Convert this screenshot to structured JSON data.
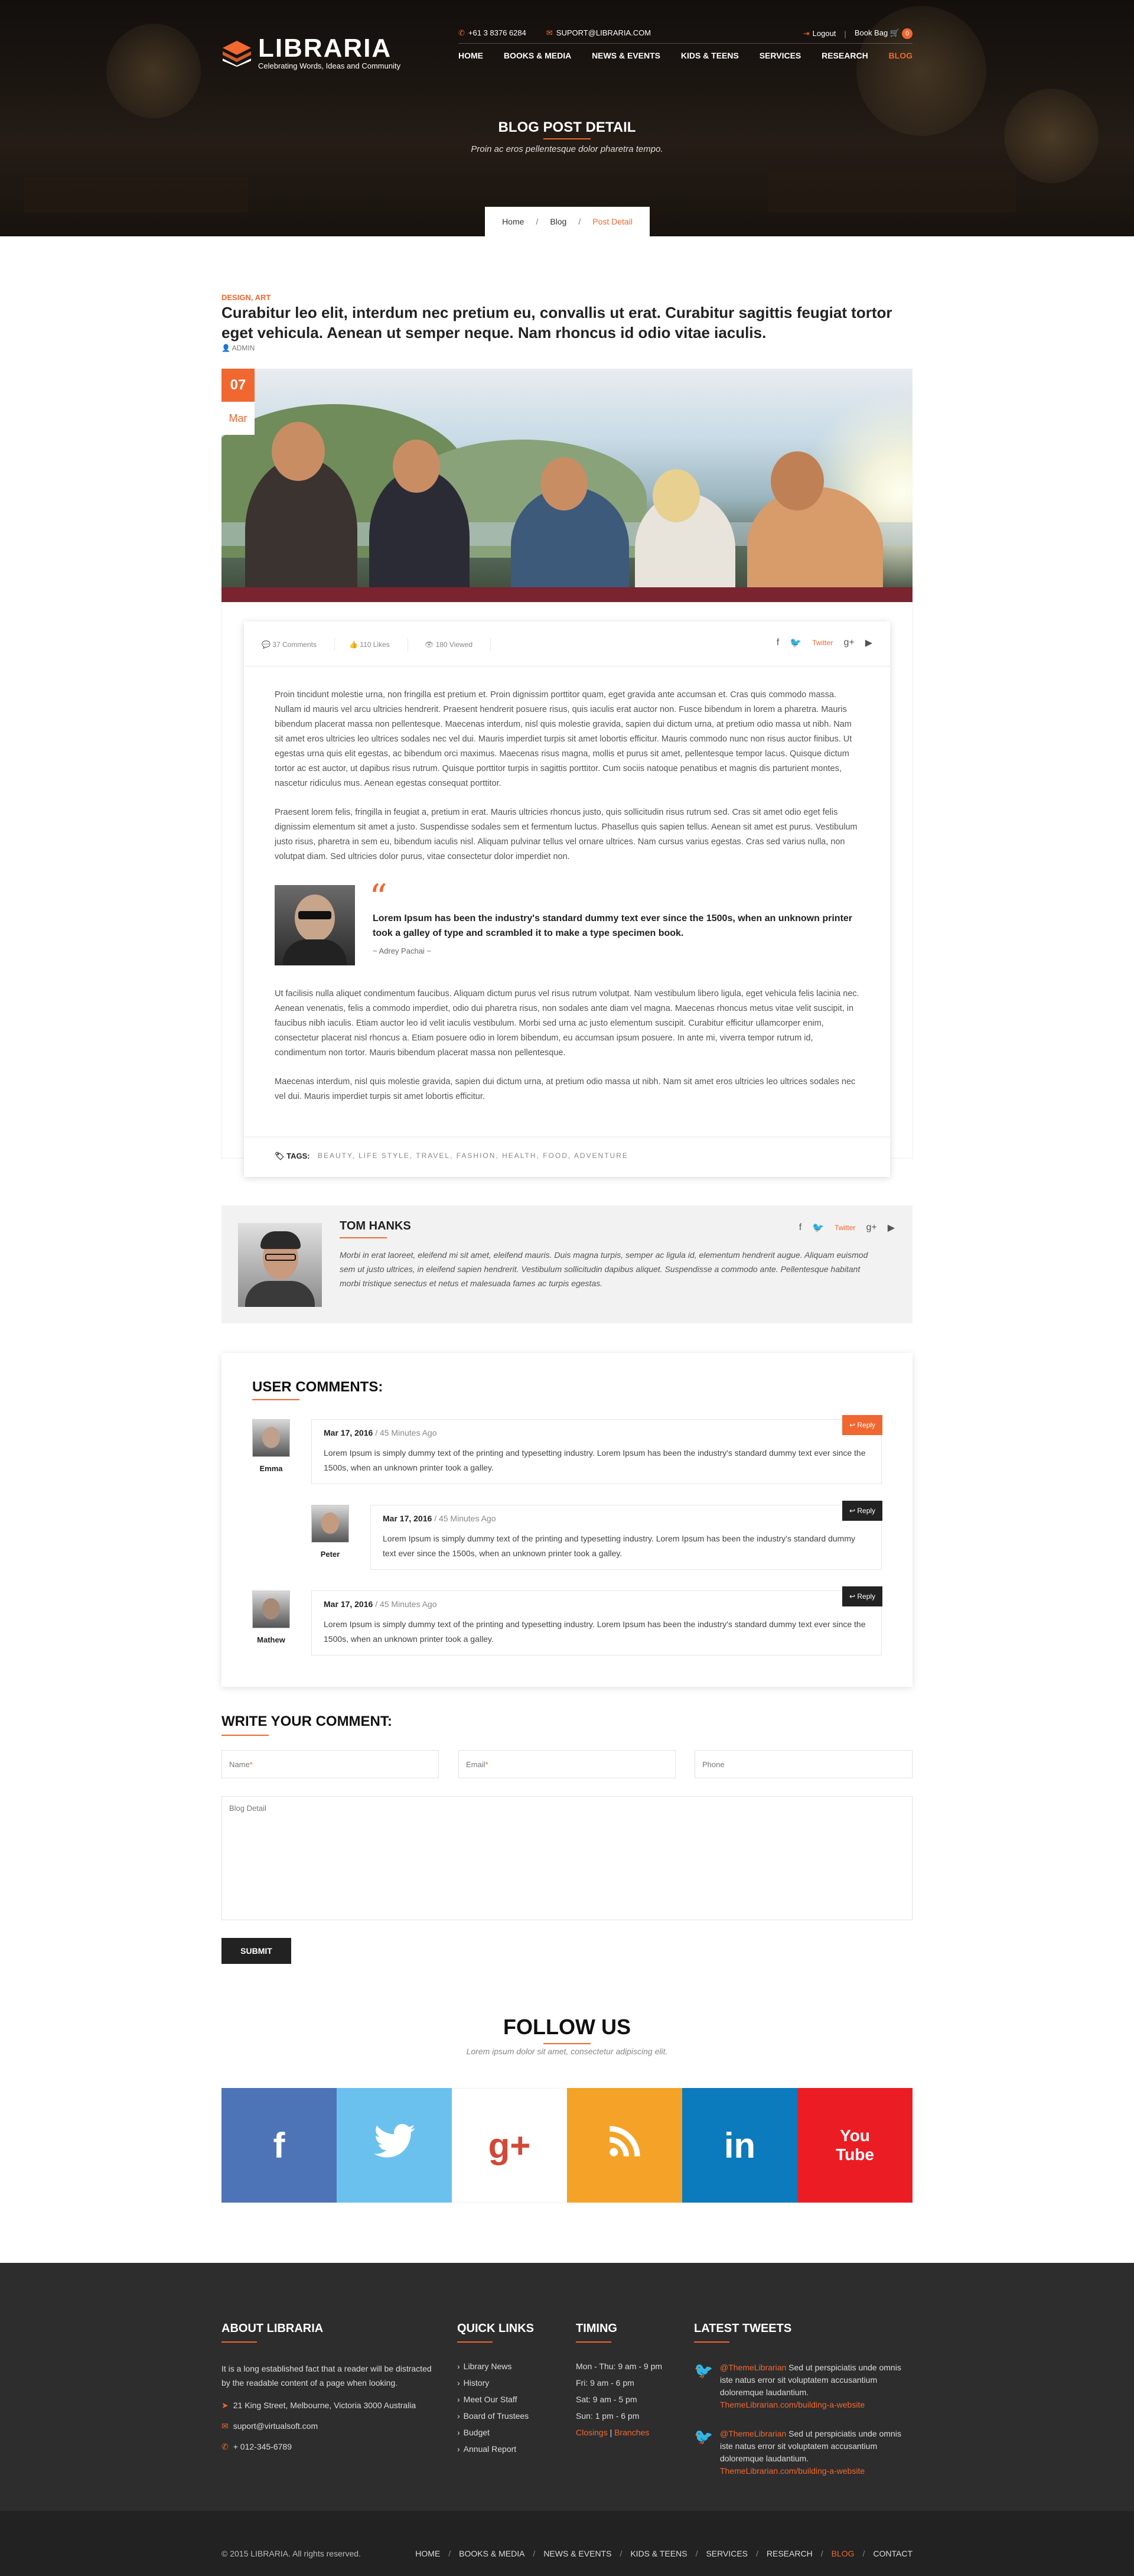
{
  "brand": {
    "name": "LIBRARIA",
    "tagline": "Celebrating Words, Ideas and Community"
  },
  "topbar": {
    "phone": "+61 3 8376 6284",
    "email": "SUPORT@LIBRARIA.COM",
    "logout": "Logout",
    "bookbag": "Book Bag",
    "bag_count": "0"
  },
  "nav": {
    "items": [
      "HOME",
      "BOOKS & MEDIA",
      "NEWS & EVENTS",
      "KIDS & TEENS",
      "SERVICES",
      "RESEARCH",
      "BLOG"
    ]
  },
  "hero": {
    "title": "BLOG POST DETAIL",
    "subtitle": "Proin ac eros pellentesque dolor pharetra tempo."
  },
  "breadcrumb": {
    "home": "Home",
    "blog": "Blog",
    "current": "Post Detail",
    "separator": "/"
  },
  "post": {
    "category": "DESIGN, ART",
    "title": "Curabitur leo elit, interdum nec pretium eu, convallis ut erat. Curabitur sagittis feugiat tortor eget vehicula. Aenean ut semper neque. Nam rhoncus id odio vitae iaculis.",
    "author": "ADMIN",
    "date_day": "07",
    "date_month": "Mar",
    "comments": "37 Comments",
    "likes": "110 Likes",
    "views": "180 Viewed",
    "twitter_label": "Twitter",
    "para1": "Proin tincidunt molestie urna, non fringilla est pretium et. Proin dignissim porttitor quam, eget gravida ante accumsan et. Cras quis commodo massa. Nullam id mauris vel arcu ultricies hendrerit. Praesent hendrerit posuere risus, quis iaculis erat auctor non. Fusce bibendum in lorem a pharetra. Mauris bibendum placerat massa non pellentesque. Maecenas interdum, nisl quis molestie gravida, sapien dui dictum urna, at pretium odio massa ut nibh. Nam sit amet eros ultricies leo ultrices sodales nec vel dui. Mauris imperdiet turpis sit amet lobortis efficitur. Mauris commodo nunc non risus auctor finibus. Ut egestas urna quis elit egestas, ac bibendum orci maximus. Maecenas risus magna, mollis et purus sit amet, pellentesque tempor lacus. Quisque dictum tortor ac est auctor, ut dapibus risus rutrum. Quisque porttitor turpis in sagittis porttitor. Cum sociis natoque penatibus et magnis dis parturient montes, nascetur ridiculus mus. Aenean egestas consequat porttitor.",
    "para2": "Praesent lorem felis, fringilla in feugiat a, pretium in erat. Mauris ultricies rhoncus justo, quis sollicitudin risus rutrum sed. Cras sit amet odio eget felis dignissim elementum sit amet a justo. Suspendisse sodales sem et fermentum luctus. Phasellus quis sapien tellus. Aenean sit amet est purus. Vestibulum justo risus, pharetra in sem eu, bibendum iaculis nisl. Aliquam pulvinar tellus vel ornare ultrices. Nam cursus varius egestas. Cras sed varius nulla, non volutpat diam. Sed ultricies dolor purus, vitae consectetur dolor imperdiet non.",
    "quote": "Lorem Ipsum has been the industry's standard dummy text ever since the 1500s, when an unknown printer took a galley of type and scrambled it to make a type specimen book.",
    "quote_author": "~ Adrey Pachai ~",
    "para3": "Ut facilisis nulla aliquet condimentum faucibus. Aliquam dictum purus vel risus rutrum volutpat. Nam vestibulum libero ligula, eget vehicula felis lacinia nec. Aenean venenatis, felis a commodo imperdiet, odio dui pharetra risus, non sodales ante diam vel magna. Maecenas rhoncus metus vitae velit suscipit, in faucibus nibh iaculis. Etiam auctor leo id velit iaculis vestibulum. Morbi sed urna ac justo elementum suscipit. Curabitur efficitur ullamcorper enim, consectetur placerat nisl rhoncus a. Etiam posuere odio in lorem bibendum, eu accumsan ipsum posuere. In ante mi, viverra tempor rutrum id, condimentum non tortor. Mauris bibendum placerat massa non pellentesque.",
    "para4": "Maecenas interdum, nisl quis molestie gravida, sapien dui dictum urna, at pretium odio massa ut nibh. Nam sit amet eros ultricies leo ultrices sodales nec vel dui. Mauris imperdiet turpis sit amet lobortis efficitur.",
    "tags_label": "TAGS:",
    "tags": "BEAUTY, LIFE STYLE, TRAVEL, FASHION, HEALTH, FOOD, ADVENTURE"
  },
  "author_box": {
    "name": "TOM HANKS",
    "twitter_label": "Twitter",
    "bio": "Morbi in erat laoreet, eleifend mi sit amet, eleifend mauris. Duis magna turpis, semper ac ligula id, elementum hendrerit augue. Aliquam euismod sem ut justo ultrices, in eleifend sapien hendrerit. Vestibulum sollicitudin dapibus aliquet. Suspendisse a commodo ante. Pellentesque habitant morbi tristique senectus et netus et malesuada fames ac turpis egestas."
  },
  "comments": {
    "title": "USER COMMENTS:",
    "reply_label": "Reply",
    "items": [
      {
        "name": "Emma",
        "date": "Mar 17, 2016",
        "ago": "45 Minutes Ago",
        "text": "Lorem Ipsum is simply dummy text of the printing and typesetting industry. Lorem Ipsum has been the industry's standard dummy text ever since the 1500s, when an unknown printer took a galley."
      },
      {
        "name": "Peter",
        "date": "Mar 17, 2016",
        "ago": "45 Minutes Ago",
        "text": "Lorem Ipsum is simply dummy text of the printing and typesetting industry. Lorem Ipsum has been the industry's standard dummy text ever since the 1500s, when an unknown printer took a galley."
      },
      {
        "name": "Mathew",
        "date": "Mar 17, 2016",
        "ago": "45 Minutes Ago",
        "text": "Lorem Ipsum is simply dummy text of the printing and typesetting industry. Lorem Ipsum has been the industry's standard dummy text ever since the 1500s, when an unknown printer took a galley."
      }
    ]
  },
  "write_comment": {
    "title": "WRITE YOUR COMMENT:",
    "name_placeholder": "Name",
    "email_placeholder": "Email",
    "phone_placeholder": "Phone",
    "detail_placeholder": "Blog Detail",
    "required_mark": "*",
    "submit": "SUBMIT"
  },
  "follow": {
    "title": "FOLLOW US",
    "subtitle": "Lorem ipsum dolor sit amet, consectetur adipiscing elit.",
    "tiles": [
      {
        "icon": "facebook-icon",
        "glyph": "f",
        "color": "#4e74b8"
      },
      {
        "icon": "twitter-icon",
        "glyph": "🐦",
        "color": "#6bc1ee"
      },
      {
        "icon": "google-plus-icon",
        "glyph": "g+",
        "color": "#ffffff"
      },
      {
        "icon": "rss-icon",
        "glyph": "◉",
        "color": "#f4a328"
      },
      {
        "icon": "linkedin-icon",
        "glyph": "in",
        "color": "#0b7bbd"
      },
      {
        "icon": "youtube-icon",
        "glyph": "You Tube",
        "color": "#ec1c24"
      }
    ]
  },
  "footer": {
    "about_title": "ABOUT LIBRARIA",
    "about_text": "It is a long established fact that a reader will be distracted by the readable content of a page when looking.",
    "address": "21 King Street, Melbourne, Victoria 3000 Australia",
    "email": "suport@virtualsoft.com",
    "phone": "+ 012-345-6789",
    "links_title": "QUICK LINKS",
    "links": [
      "Library News",
      "History",
      "Meet Our Staff",
      "Board of Trustees",
      "Budget",
      "Annual Report"
    ],
    "timing_title": "TIMING",
    "timing": [
      "Mon - Thu: 9 am - 9 pm",
      "Fri: 9 am - 6 pm",
      "Sat: 9 am - 5 pm",
      "Sun: 1 pm - 6 pm"
    ],
    "closings": "Closings",
    "branches": "Branches",
    "timing_sep": "|",
    "tweets_title": "LATEST TWEETS",
    "tweets": [
      {
        "handle": "@ThemeLibrarian",
        "text": " Sed ut perspiciatis unde omnis iste natus error sit voluptatem accusantium doloremque laudantium. ",
        "link": "ThemeLibrarian.com/building-a-website"
      },
      {
        "handle": "@ThemeLibrarian",
        "text": " Sed ut perspiciatis unde omnis iste natus error sit voluptatem accusantium doloremque laudantium. ",
        "link": "ThemeLibrarian.com/building-a-website"
      }
    ],
    "copyright": "© 2015 LIBRARIA. All rights reserved.",
    "bottom_nav": [
      "HOME",
      "BOOKS & MEDIA",
      "NEWS & EVENTS",
      "KIDS & TEENS",
      "SERVICES",
      "RESEARCH",
      "BLOG",
      "CONTACT"
    ]
  },
  "colors": {
    "accent": "#f16730",
    "dark": "#222222",
    "footer": "#2d2d2d"
  }
}
